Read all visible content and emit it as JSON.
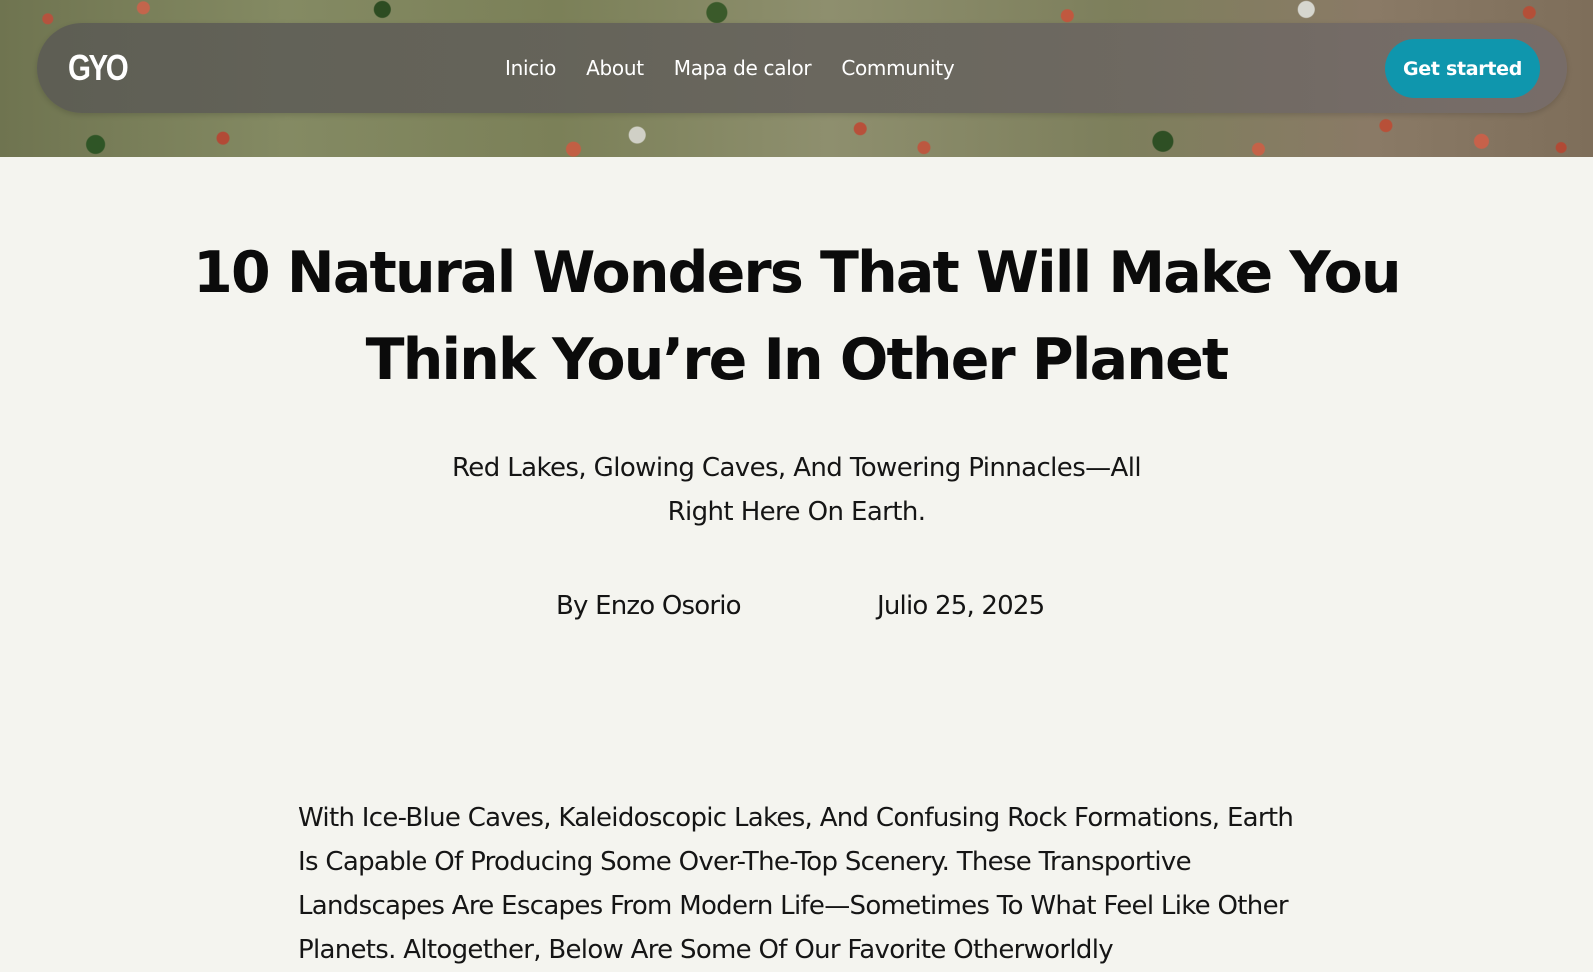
{
  "header": {
    "logo": "GYO",
    "nav": [
      {
        "label": "Inicio"
      },
      {
        "label": "About"
      },
      {
        "label": "Mapa de calor"
      },
      {
        "label": "Community"
      }
    ],
    "cta_label": "Get started"
  },
  "colors": {
    "accent": "#0f96ad",
    "page_background": "#f4f4ef",
    "text": "#141414"
  },
  "article": {
    "title": "10 Natural Wonders That Will Make You Think You’re In Other Planet",
    "subtitle": "Red Lakes, Glowing Caves, And Towering Pinnacles—All Right Here On Earth.",
    "author": "By Enzo Osorio",
    "date": "Julio 25, 2025",
    "intro": "With Ice-Blue Caves, Kaleidoscopic Lakes, And Confusing Rock Formations, Earth Is Capable Of Producing Some Over-The-Top Scenery. These Transportive Landscapes Are Escapes From Modern Life—Sometimes To What Feel Like Other Planets. Altogether, Below Are Some Of Our Favorite Otherworldly"
  }
}
